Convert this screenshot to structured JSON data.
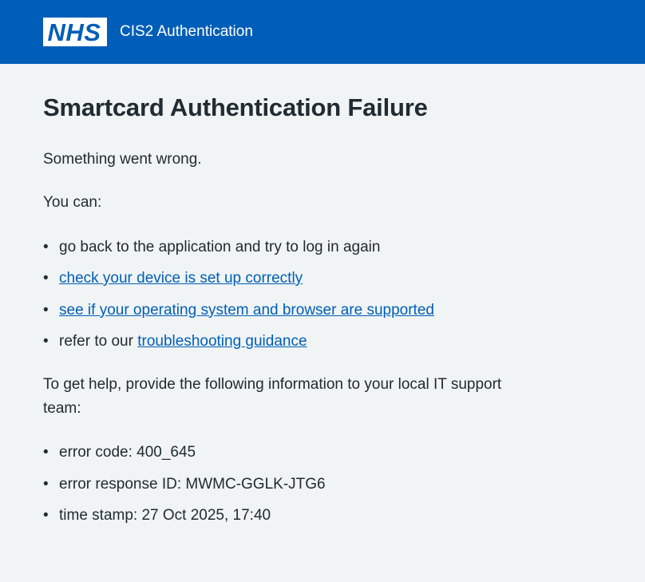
{
  "header": {
    "logo_text": "NHS",
    "service_name": "CIS2 Authentication"
  },
  "main": {
    "title": "Smartcard Authentication Failure",
    "intro": "Something went wrong.",
    "you_can": "You can:",
    "options": {
      "item1": "go back to the application and try to log in again",
      "item2_link": "check your device is set up correctly",
      "item3_link": "see if your operating system and browser are supported",
      "item4_prefix": "refer to our ",
      "item4_link": "troubleshooting guidance"
    },
    "help_text": "To get help, provide the following information to your local IT support team:",
    "details": {
      "error_code": "error code: 400_645",
      "error_response_id": "error response ID: MWMC-GGLK-JTG6",
      "time_stamp": "time stamp: 27 Oct 2025, 17:40"
    }
  },
  "colors": {
    "header_bg": "#005eb8",
    "page_bg": "#f0f4f5",
    "link": "#005eb8",
    "text": "#212b32"
  }
}
